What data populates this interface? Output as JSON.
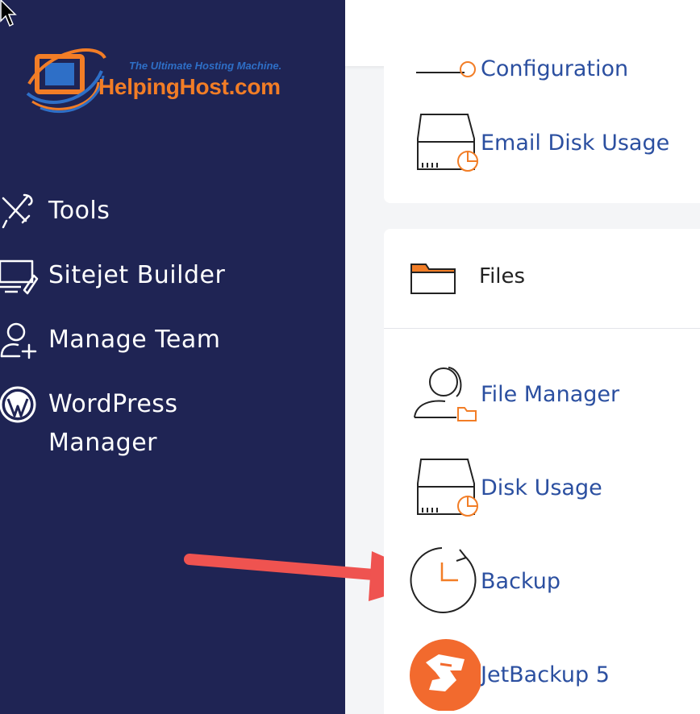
{
  "logo": {
    "tagline": "The Ultimate Hosting Machine.",
    "name": "HelpingHost.com",
    "colors": {
      "orange": "#f27d26",
      "blue": "#2e6fc7"
    }
  },
  "sidebar": {
    "background": "#1f2454",
    "items": [
      {
        "label": "Tools",
        "icon": "tools-icon"
      },
      {
        "label": "Sitejet Builder",
        "icon": "monitor-pen-icon"
      },
      {
        "label": "Manage Team",
        "icon": "user-add-icon"
      },
      {
        "label": "WordPress Manager",
        "icon": "wordpress-icon"
      }
    ]
  },
  "email_section": {
    "partial_label": "Configuration",
    "items": [
      {
        "label": "Email Disk Usage",
        "icon": "disk-usage-icon"
      }
    ]
  },
  "files_section": {
    "title": "Files",
    "icon": "folder-icon",
    "items": [
      {
        "label": "File Manager",
        "icon": "file-manager-icon"
      },
      {
        "label": "Disk Usage",
        "icon": "disk-usage-icon"
      },
      {
        "label": "Backup",
        "icon": "backup-icon"
      },
      {
        "label": "JetBackup 5",
        "icon": "jetbackup-icon"
      }
    ]
  },
  "colors": {
    "link": "#2b4fa0",
    "accent": "#f27d26",
    "arrow": "#ef5350"
  }
}
